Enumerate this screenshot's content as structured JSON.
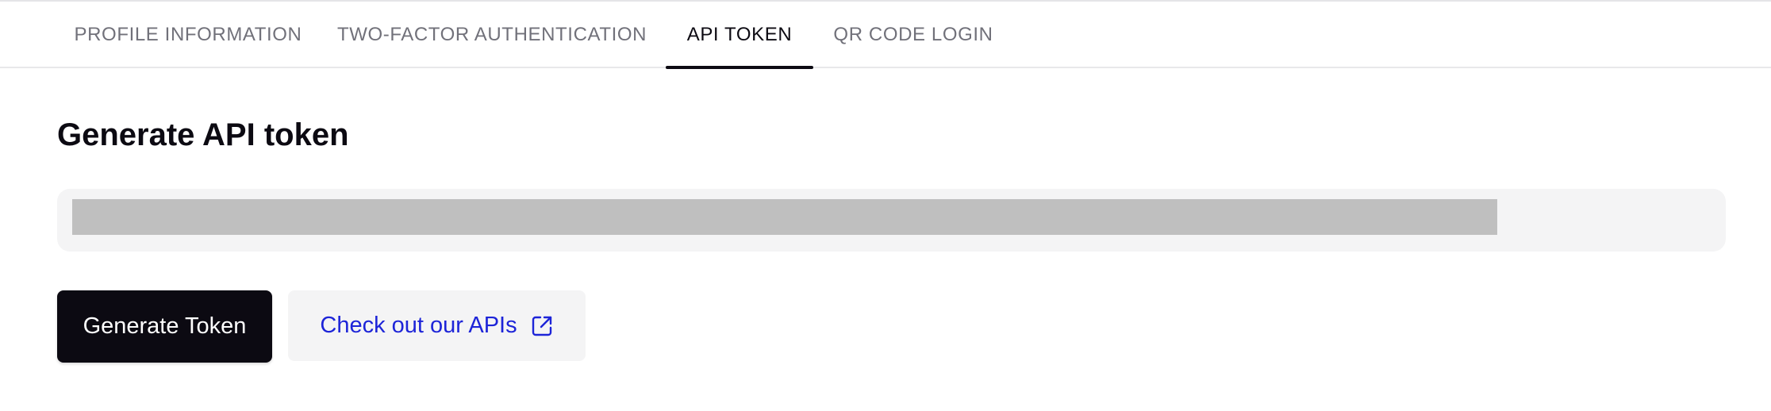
{
  "tabs": [
    {
      "label": "PROFILE INFORMATION",
      "active": false
    },
    {
      "label": "TWO-FACTOR AUTHENTICATION",
      "active": false
    },
    {
      "label": "API TOKEN",
      "active": true
    },
    {
      "label": "QR CODE LOGIN",
      "active": false
    }
  ],
  "section": {
    "title": "Generate API token"
  },
  "token": {
    "value_redacted": true
  },
  "actions": {
    "generate_label": "Generate Token",
    "apis_label": "Check out our APIs",
    "apis_icon": "external-link-icon"
  },
  "colors": {
    "primary_button": "#0c0a12",
    "link": "#1d24d8",
    "field_background": "#f4f4f5",
    "redaction": "#bfbfbf"
  }
}
